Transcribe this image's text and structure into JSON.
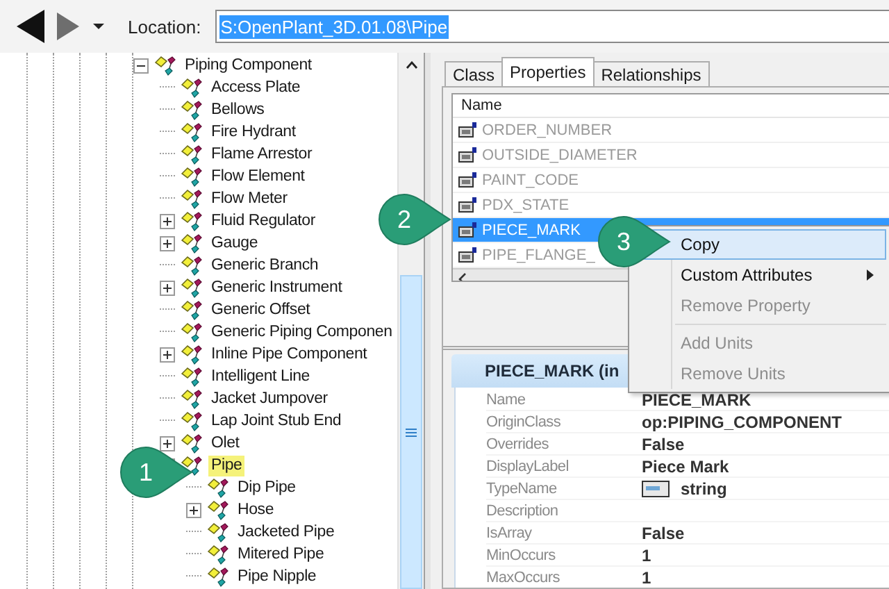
{
  "toolbar": {
    "location_label": "Location:",
    "location": {
      "value": "S:OpenPlant_3D.01.08\\Pipe",
      "selected": true
    }
  },
  "tree": [
    {
      "label": "Piping Component",
      "has_children": true,
      "expanded": true,
      "selected": false,
      "children": [
        {
          "label": "Access Plate",
          "has_children": false,
          "expanded": false,
          "selected": false
        },
        {
          "label": "Bellows",
          "has_children": false,
          "expanded": false,
          "selected": false
        },
        {
          "label": "Fire Hydrant",
          "has_children": false,
          "expanded": false,
          "selected": false
        },
        {
          "label": "Flame Arrestor",
          "has_children": false,
          "expanded": false,
          "selected": false
        },
        {
          "label": "Flow Element",
          "has_children": false,
          "expanded": false,
          "selected": false
        },
        {
          "label": "Flow Meter",
          "has_children": false,
          "expanded": false,
          "selected": false
        },
        {
          "label": "Fluid Regulator",
          "has_children": true,
          "expanded": false,
          "selected": false
        },
        {
          "label": "Gauge",
          "has_children": true,
          "expanded": false,
          "selected": false
        },
        {
          "label": "Generic Branch",
          "has_children": false,
          "expanded": false,
          "selected": false
        },
        {
          "label": "Generic Instrument",
          "has_children": true,
          "expanded": false,
          "selected": false
        },
        {
          "label": "Generic Offset",
          "has_children": false,
          "expanded": false,
          "selected": false
        },
        {
          "label": "Generic Piping Componen",
          "has_children": false,
          "expanded": false,
          "selected": false
        },
        {
          "label": "Inline Pipe Component",
          "has_children": true,
          "expanded": false,
          "selected": false
        },
        {
          "label": "Intelligent Line",
          "has_children": false,
          "expanded": false,
          "selected": false
        },
        {
          "label": "Jacket Jumpover",
          "has_children": false,
          "expanded": false,
          "selected": false
        },
        {
          "label": "Lap Joint Stub End",
          "has_children": false,
          "expanded": false,
          "selected": false
        },
        {
          "label": "Olet",
          "has_children": true,
          "expanded": false,
          "selected": false
        },
        {
          "label": "Pipe",
          "has_children": true,
          "expanded": true,
          "selected": true,
          "children": [
            {
              "label": "Dip Pipe",
              "has_children": false,
              "expanded": false,
              "selected": false
            },
            {
              "label": "Hose",
              "has_children": true,
              "expanded": false,
              "selected": false
            },
            {
              "label": "Jacketed Pipe",
              "has_children": false,
              "expanded": false,
              "selected": false
            },
            {
              "label": "Mitered Pipe",
              "has_children": false,
              "expanded": false,
              "selected": false
            },
            {
              "label": "Pipe Nipple",
              "has_children": false,
              "expanded": false,
              "selected": false
            }
          ]
        }
      ]
    }
  ],
  "tabs": [
    {
      "label": "Class",
      "selected": false
    },
    {
      "label": "Properties",
      "selected": true
    },
    {
      "label": "Relationships",
      "selected": false
    }
  ],
  "properties": {
    "column": "Name",
    "rows": [
      {
        "name": "ORDER_NUMBER",
        "selected": false
      },
      {
        "name": "OUTSIDE_DIAMETER",
        "selected": false
      },
      {
        "name": "PAINT_CODE",
        "selected": false
      },
      {
        "name": "PDX_STATE",
        "selected": false
      },
      {
        "name": "PIECE_MARK",
        "selected": true
      },
      {
        "name": "PIPE_FLANGE_",
        "selected": false
      }
    ]
  },
  "details": {
    "title": "PIECE_MARK (in",
    "rows": [
      {
        "label": "Name",
        "value": "PIECE_MARK",
        "kind": "text"
      },
      {
        "label": "OriginClass",
        "value": "op:PIPING_COMPONENT",
        "kind": "text"
      },
      {
        "label": "Overrides",
        "value": "False",
        "kind": "text"
      },
      {
        "label": "DisplayLabel",
        "value": "Piece Mark",
        "kind": "text"
      },
      {
        "label": "TypeName",
        "value": "string",
        "kind": "type"
      },
      {
        "label": "Description",
        "kind": "empty"
      },
      {
        "label": "IsArray",
        "value": "False",
        "kind": "text"
      },
      {
        "label": "MinOccurs",
        "value": "1",
        "kind": "text"
      },
      {
        "label": "MaxOccurs",
        "value": "1",
        "kind": "text"
      }
    ]
  },
  "context_menu": [
    {
      "kind": "item",
      "label": "Copy",
      "selected": true,
      "disabled": false,
      "submenu": false
    },
    {
      "kind": "item",
      "label": "Custom Attributes",
      "selected": false,
      "disabled": false,
      "submenu": true
    },
    {
      "kind": "item",
      "label": "Remove Property",
      "selected": false,
      "disabled": true,
      "submenu": false
    },
    {
      "kind": "separator"
    },
    {
      "kind": "item",
      "label": "Add Units",
      "selected": false,
      "disabled": true,
      "submenu": false
    },
    {
      "kind": "item",
      "label": "Remove Units",
      "selected": false,
      "disabled": true,
      "submenu": false
    }
  ],
  "callouts": [
    {
      "number": "1",
      "kind": "tree"
    },
    {
      "number": "2",
      "kind": "property"
    },
    {
      "number": "3",
      "kind": "menu"
    }
  ]
}
